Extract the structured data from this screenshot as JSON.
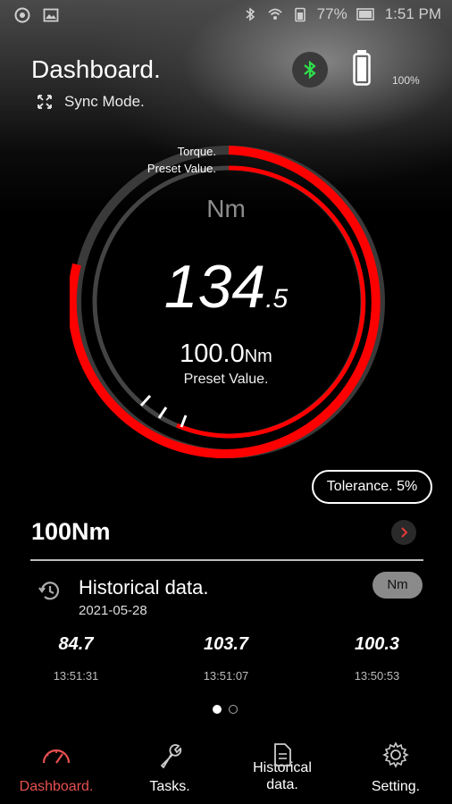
{
  "status_bar": {
    "battery_pct": "77%",
    "time": "1:51 PM"
  },
  "header": {
    "title": "Dashboard.",
    "mode": "Sync Mode.",
    "device_battery": "100%"
  },
  "gauge": {
    "torque_label": "Torque.",
    "preset_label_top": "Preset Value.",
    "unit": "Nm",
    "reading_int": "134",
    "reading_dec": ".5",
    "preset_value": "100.0",
    "preset_unit": "Nm",
    "preset_caption": "Preset Value.",
    "accent": "#ff0000"
  },
  "tolerance": "Tolerance. 5%",
  "task": {
    "title": "100Nm"
  },
  "history": {
    "title": "Historical data.",
    "date": "2021-05-28",
    "unit_chip": "Nm",
    "records": [
      {
        "value": "84.7",
        "time": "13:51:31"
      },
      {
        "value": "103.7",
        "time": "13:51:07"
      },
      {
        "value": "100.3",
        "time": "13:50:53"
      }
    ]
  },
  "nav": {
    "items": [
      {
        "label": "Dashboard.",
        "icon": "speedometer-icon"
      },
      {
        "label": "Tasks.",
        "icon": "wrench-icon"
      },
      {
        "label": "Historical\ndata.",
        "icon": "document-icon"
      },
      {
        "label": "Setting.",
        "icon": "gear-icon"
      }
    ],
    "active_color": "#e85050"
  }
}
